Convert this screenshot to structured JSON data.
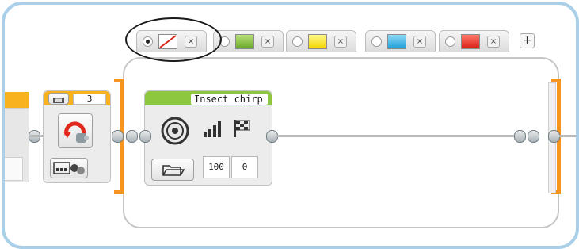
{
  "switch_tabs": [
    {
      "selected": true,
      "swatch": "no-color-icon",
      "swatch_color": "#ffffff"
    },
    {
      "selected": false,
      "swatch": "green-color-icon",
      "swatch_color": "#8dc63f"
    },
    {
      "selected": false,
      "swatch": "yellow-color-icon",
      "swatch_color": "#fff200"
    },
    {
      "selected": false,
      "swatch": "blue-color-icon",
      "swatch_color": "#29abe2"
    },
    {
      "selected": false,
      "swatch": "red-color-icon",
      "swatch_color": "#e8261f"
    }
  ],
  "tab_close_glyph": "×",
  "add_case_glyph": "+",
  "loop_block": {
    "count_value": "3",
    "head_color": "#f7b21d"
  },
  "sound_block": {
    "title": "Insect chirp",
    "volume": "100",
    "play_type": "0",
    "head_color": "#8dc63f"
  },
  "colors": {
    "switch_accent": "#f7941d",
    "frame_border": "#a9cfe9"
  }
}
